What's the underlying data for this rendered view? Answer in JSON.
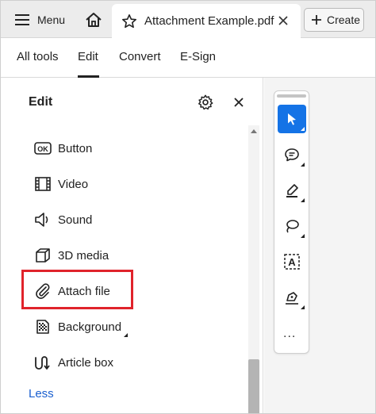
{
  "tabbar": {
    "menu_label": "Menu",
    "document_tab_title": "Attachment Example.pdf",
    "create_label": "Create"
  },
  "nav": {
    "items": [
      "All tools",
      "Edit",
      "Convert",
      "E-Sign"
    ],
    "active": "Edit"
  },
  "panel": {
    "title": "Edit",
    "tools": [
      {
        "label": "Button",
        "icon": "ok-button-icon"
      },
      {
        "label": "Video",
        "icon": "film-icon"
      },
      {
        "label": "Sound",
        "icon": "speaker-icon"
      },
      {
        "label": "3D media",
        "icon": "cube-icon"
      },
      {
        "label": "Attach file",
        "icon": "paperclip-icon",
        "highlighted": true
      },
      {
        "label": "Background",
        "icon": "background-icon",
        "has_submenu": true
      },
      {
        "label": "Article box",
        "icon": "article-box-icon"
      }
    ],
    "less_label": "Less"
  },
  "right_toolbar": {
    "tools": [
      "select-cursor-icon",
      "add-comment-icon",
      "highlight-pen-icon",
      "draw-lasso-icon",
      "add-text-box-icon",
      "sign-pen-icon",
      "more-options-icon"
    ],
    "selected": "select-cursor-icon",
    "more_label": "..."
  },
  "colors": {
    "accent_blue": "#1473e6",
    "highlight_red": "#e0232b",
    "link_blue": "#1a5fcf",
    "tabbar_bg": "#ececec"
  }
}
